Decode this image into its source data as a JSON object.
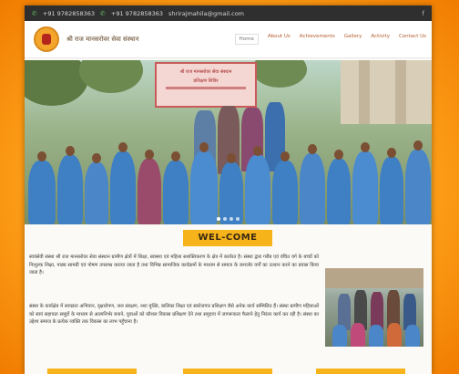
{
  "topbar": {
    "phone_1": "+91 9782858363",
    "phone_2": "+91 9782858363",
    "email": "shrirajmahila@gmail.com"
  },
  "header": {
    "site_name": "श्री राज मानसरोवर सेवा संस्थान"
  },
  "nav": {
    "items": [
      "Home",
      "About Us",
      "Achievements",
      "Gallery",
      "Activity",
      "Contact Us"
    ],
    "active_index": 0
  },
  "hero": {
    "banner_line_1": "श्री राज मानसरोवर सेवा संस्थान",
    "banner_line_2": "प्रशिक्षण शिविर",
    "slide_count": 4,
    "active_slide": 0
  },
  "welcome": {
    "title": "WEL-COME"
  },
  "body": {
    "paragraph_1": "स्वयंसेवी संस्था श्री राज मानसरोवर सेवा संस्थान ग्रामीण क्षेत्रों में शिक्षा, स्वास्थ्य एवं महिला सशक्तिकरण के क्षेत्र में कार्यरत है। संस्था द्वारा गरीब एवं वंचित वर्ग के बच्चों को निःशुल्क शिक्षा, पाठ्य सामग्री एवं पोषण उपलब्ध कराया जाता है तथा विभिन्न सामाजिक कार्यक्रमों के माध्यम से समाज के कमजोर वर्गों का उत्थान करने का प्रयास किया जाता है।",
    "paragraph_2": "संस्था के कार्यक्षेत्र में स्वच्छता अभियान, वृक्षारोपण, जल संरक्षण, नशा मुक्ति, बालिका शिक्षा एवं स्वरोजगार प्रशिक्षण जैसे अनेक कार्य सम्मिलित हैं। संस्था ग्रामीण महिलाओं को स्वयं सहायता समूहों के माध्यम से आत्मनिर्भर बनाने, युवाओं को कौशल विकास प्रशिक्षण देने तथा समुदाय में जागरूकता फैलाने हेतु निरंतर कार्य कर रही है। संस्था का उद्देश्य समाज के प्रत्येक व्यक्ति तक विकास का लाभ पहुँचाना है।"
  },
  "colors": {
    "accent": "#f6b31a",
    "topbar": "#2f2f2f",
    "menu_text": "#b35a2a"
  }
}
